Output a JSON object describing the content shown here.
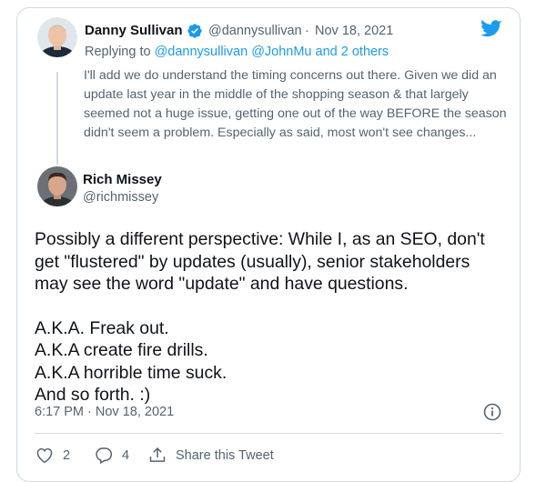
{
  "quoted_tweet": {
    "author_name": "Danny Sullivan",
    "handle": "@dannysullivan",
    "separator": "·",
    "date": "Nov 18, 2021",
    "replying_to_prefix": "Replying to",
    "replying_to_handles": "@dannysullivan @JohnMu",
    "replying_to_suffix": "and 2 others",
    "text": "I'll add we do understand the timing concerns out there. Given we did an update last year in the middle of the shopping season & that largely seemed not a huge issue, getting one out of the way BEFORE the season didn't seem a problem. Especially as said, most won't see changes..."
  },
  "main_tweet": {
    "author_name": "Rich Missey",
    "handle": "@richmissey",
    "paragraph1": "Possibly a different perspective: While I, as an SEO, don't get \"flustered\" by updates (usually), senior stakeholders may see the word \"update\" and have questions.",
    "lines": [
      "A.K.A. Freak out.",
      "A.K.A create fire drills.",
      "A.K.A horrible time suck.",
      "And so forth. :)"
    ],
    "timestamp": "6:17 PM · Nov 18, 2021"
  },
  "actions": {
    "likes": "2",
    "replies": "4",
    "share_label": "Share this Tweet"
  },
  "colors": {
    "accent": "#1d9bf0",
    "secondary_text": "#536471",
    "border": "#cfd9de"
  },
  "icons": [
    "twitter-bird-icon",
    "verified-badge-icon",
    "info-icon",
    "heart-icon",
    "reply-bubble-icon",
    "share-icon"
  ]
}
